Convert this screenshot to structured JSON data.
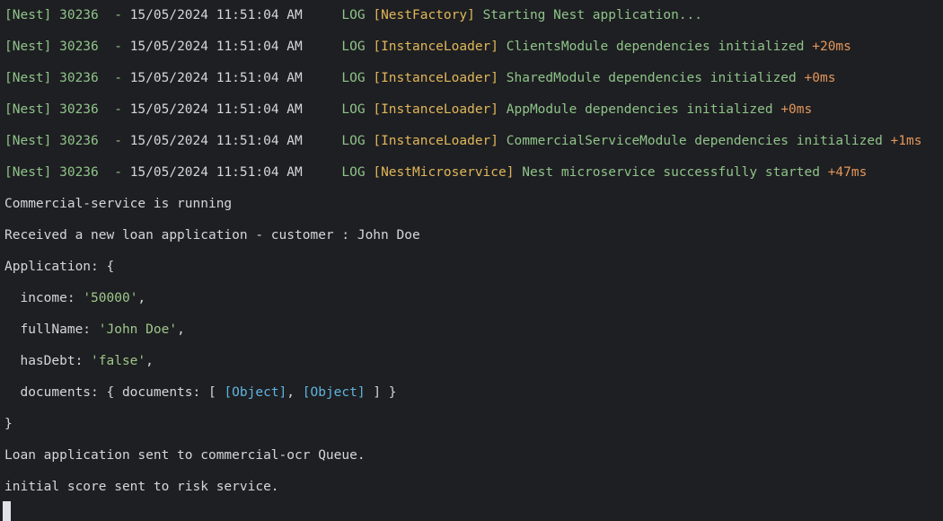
{
  "log_lines": [
    {
      "prefix": "[Nest] 30236  - ",
      "timestamp": "15/05/2024 11:51:04 AM",
      "level": "LOG",
      "context": "[NestFactory]",
      "message": "Starting Nest application...",
      "duration": ""
    },
    {
      "prefix": "[Nest] 30236  - ",
      "timestamp": "15/05/2024 11:51:04 AM",
      "level": "LOG",
      "context": "[InstanceLoader]",
      "message": "ClientsModule dependencies initialized",
      "duration": "+20ms"
    },
    {
      "prefix": "[Nest] 30236  - ",
      "timestamp": "15/05/2024 11:51:04 AM",
      "level": "LOG",
      "context": "[InstanceLoader]",
      "message": "SharedModule dependencies initialized",
      "duration": "+0ms"
    },
    {
      "prefix": "[Nest] 30236  - ",
      "timestamp": "15/05/2024 11:51:04 AM",
      "level": "LOG",
      "context": "[InstanceLoader]",
      "message": "AppModule dependencies initialized",
      "duration": "+0ms"
    },
    {
      "prefix": "[Nest] 30236  - ",
      "timestamp": "15/05/2024 11:51:04 AM",
      "level": "LOG",
      "context": "[InstanceLoader]",
      "message": "CommercialServiceModule dependencies initialized",
      "duration": "+1ms"
    },
    {
      "prefix": "[Nest] 30236  - ",
      "timestamp": "15/05/2024 11:51:04 AM",
      "level": "LOG",
      "context": "[NestMicroservice]",
      "message": "Nest microservice successfully started",
      "duration": "+47ms"
    }
  ],
  "output": {
    "running": "Commercial-service is running",
    "received": "Received a new loan application - customer : John Doe",
    "application_open": "Application: {",
    "income_key": "  income: ",
    "income_value": "'50000'",
    "income_comma": ",",
    "fullname_key": "  fullName: ",
    "fullname_value": "'John Doe'",
    "fullname_comma": ",",
    "hasdebt_key": "  hasDebt: ",
    "hasdebt_value": "'false'",
    "hasdebt_comma": ",",
    "documents_key": "  documents: { documents: [ ",
    "documents_obj1": "[Object]",
    "documents_sep": ", ",
    "documents_obj2": "[Object]",
    "documents_close": " ] }",
    "application_close": "}",
    "sent_ocr": "Loan application sent to commercial-ocr Queue.",
    "sent_risk": "initial score sent to risk service."
  },
  "colors": {
    "background": "#1e1f22",
    "default_text": "#d4d6da",
    "log_green": "#8fc38a",
    "context_yellow": "#e0b75a",
    "duration_orange": "#e2965b",
    "string_green": "#9ec78b",
    "object_blue": "#5fb4e0",
    "cursor": "#dfe3e8"
  }
}
